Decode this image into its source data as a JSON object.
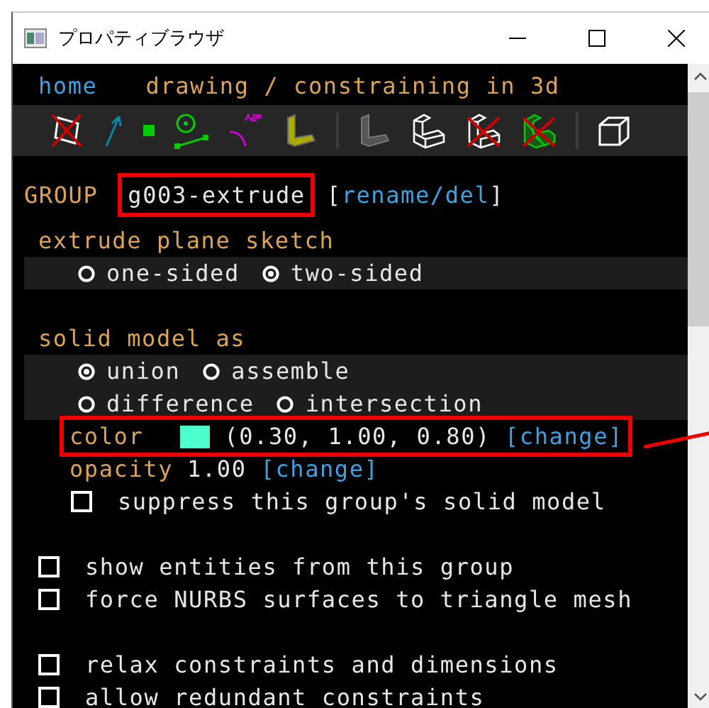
{
  "window": {
    "title": "プロパティブラウザ"
  },
  "nav": {
    "home": "home",
    "breadcrumb": "drawing / constraining in 3d"
  },
  "group": {
    "label": "GROUP",
    "name": "g003-extrude",
    "highlighted": true,
    "bracket_open": "[",
    "rename": "rename",
    "separator": "/",
    "delete": "del",
    "bracket_close": "]"
  },
  "extrude": {
    "title": "extrude plane sketch",
    "rows": [
      [
        {
          "label": "one-sided",
          "selected": false
        },
        {
          "label": "two-sided",
          "selected": true
        }
      ]
    ]
  },
  "solid": {
    "title": "solid model as",
    "rows": [
      [
        {
          "label": "union",
          "selected": true
        },
        {
          "label": "assemble",
          "selected": false
        }
      ],
      [
        {
          "label": "difference",
          "selected": false
        },
        {
          "label": "intersection",
          "selected": false
        }
      ]
    ]
  },
  "color_row": {
    "label": "color",
    "color": "#4dffcc",
    "value": "(0.30, 1.00, 0.80)",
    "link": "[change]",
    "highlighted": true
  },
  "opacity_row": {
    "label": "opacity",
    "value": "1.00",
    "link": "[change]"
  },
  "suppress": {
    "label": "suppress this group's solid model",
    "checked": false
  },
  "options": [
    [
      {
        "label": "show entities from this group",
        "checked": false
      },
      {
        "label": "force NURBS surfaces to triangle mesh",
        "checked": false
      }
    ],
    [
      {
        "label": "relax constraints and dimensions",
        "checked": false
      },
      {
        "label": "allow redundant constraints",
        "checked": false
      }
    ]
  ]
}
